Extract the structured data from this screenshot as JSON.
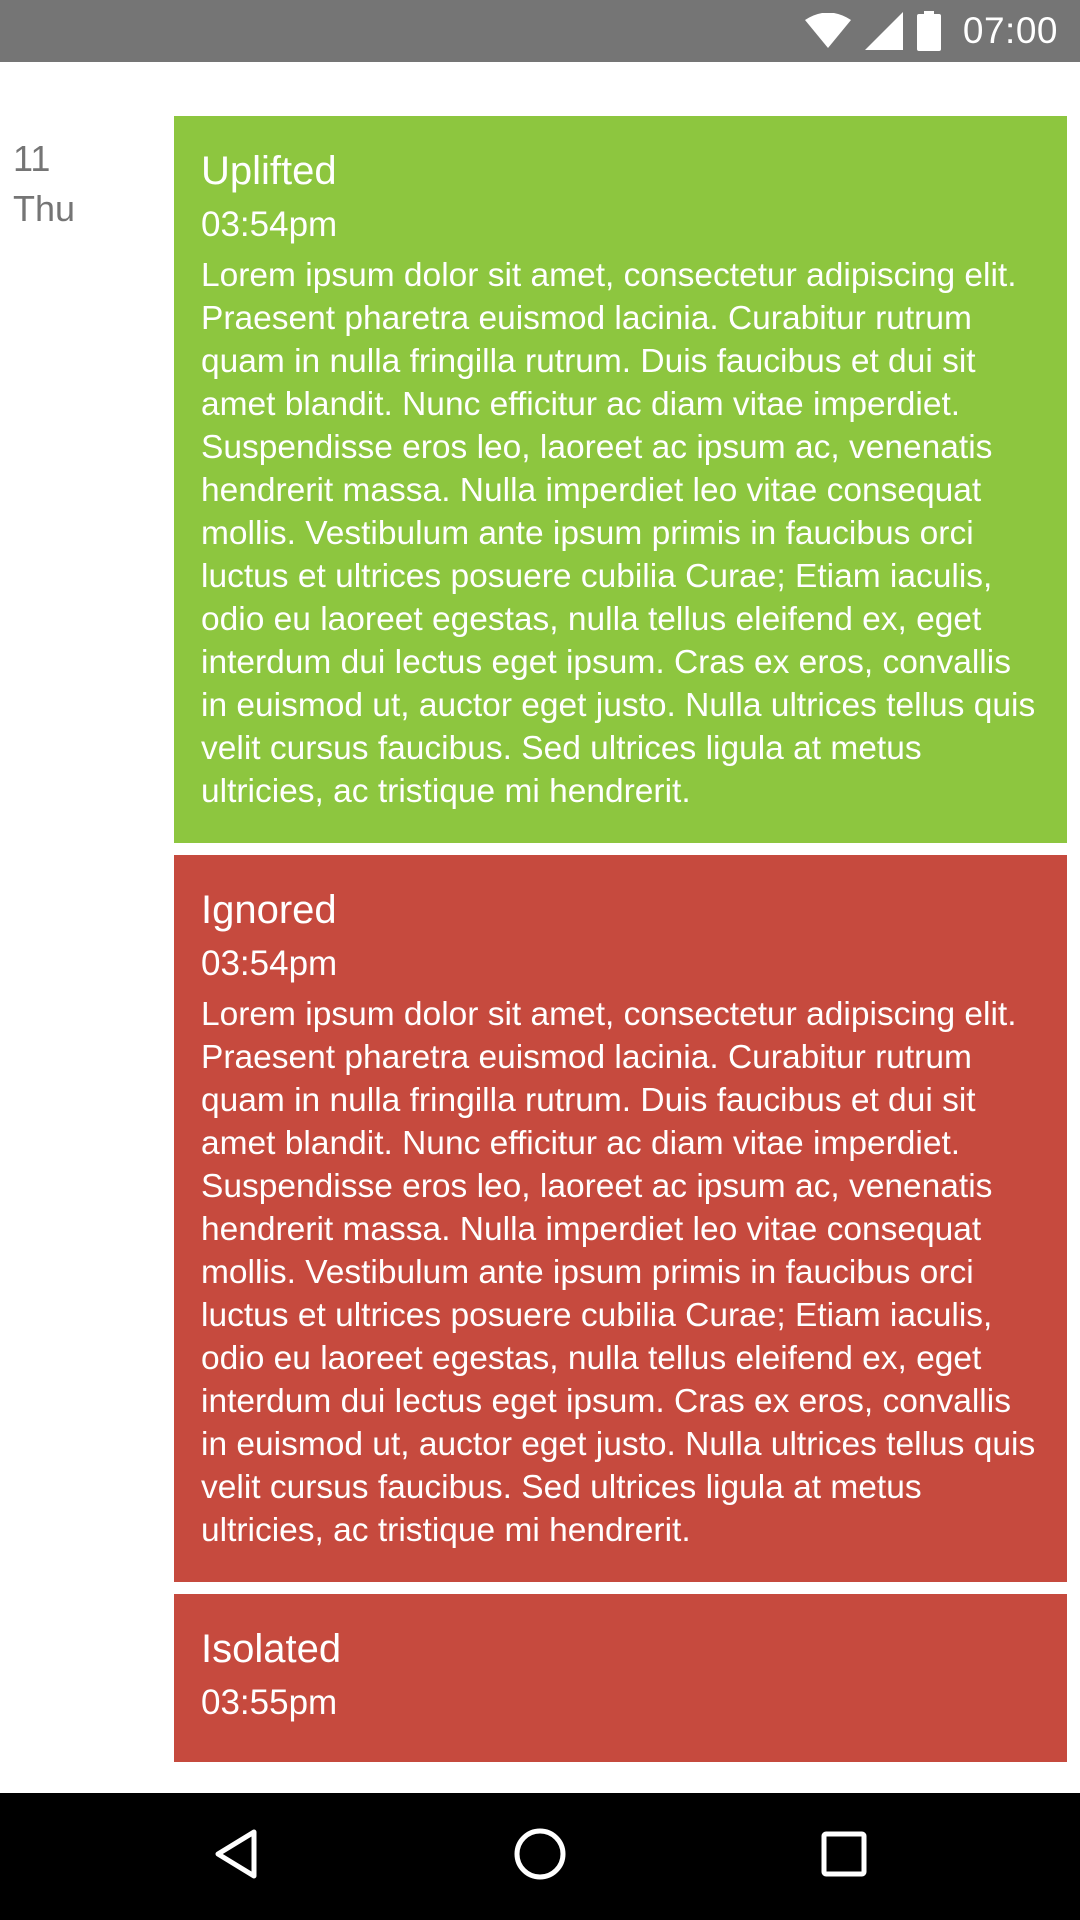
{
  "status_bar": {
    "time": "07:00",
    "icons": [
      "wifi-icon",
      "cell-signal-icon",
      "battery-icon"
    ]
  },
  "day": {
    "day_number": "11",
    "day_name": "Thu"
  },
  "entries": [
    {
      "title": "Uplifted",
      "time": "03:54pm",
      "body": "Lorem ipsum dolor sit amet, consectetur adipiscing elit. Praesent pharetra euismod lacinia. Curabitur rutrum quam in nulla fringilla rutrum. Duis faucibus et dui sit amet blandit. Nunc efficitur ac diam vitae imperdiet. Suspendisse eros leo, laoreet ac ipsum ac, venenatis hendrerit massa. Nulla imperdiet leo vitae consequat mollis. Vestibulum ante ipsum primis in faucibus orci luctus et ultrices posuere cubilia Curae; Etiam iaculis, odio eu laoreet egestas, nulla tellus eleifend ex, eget interdum dui lectus eget ipsum. Cras ex eros, convallis in euismod ut, auctor eget justo. Nulla ultrices tellus quis velit cursus faucibus. Sed ultrices ligula at metus ultricies, ac tristique mi hendrerit.",
      "color": "#8dc63f"
    },
    {
      "title": "Ignored",
      "time": "03:54pm",
      "body": "Lorem ipsum dolor sit amet, consectetur adipiscing elit. Praesent pharetra euismod lacinia. Curabitur rutrum quam in nulla fringilla rutrum. Duis faucibus et dui sit amet blandit. Nunc efficitur ac diam vitae imperdiet. Suspendisse eros leo, laoreet ac ipsum ac, venenatis hendrerit massa. Nulla imperdiet leo vitae consequat mollis. Vestibulum ante ipsum primis in faucibus orci luctus et ultrices posuere cubilia Curae; Etiam iaculis, odio eu laoreet egestas, nulla tellus eleifend ex, eget interdum dui lectus eget ipsum. Cras ex eros, convallis in euismod ut, auctor eget justo. Nulla ultrices tellus quis velit cursus faucibus. Sed ultrices ligula at metus ultricies, ac tristique mi hendrerit.",
      "color": "#c64a3e"
    },
    {
      "title": "Isolated",
      "time": "03:55pm",
      "body": "",
      "color": "#c64a3e"
    }
  ],
  "nav_bar": {
    "icons": [
      "back-icon",
      "home-icon",
      "recents-icon"
    ]
  }
}
